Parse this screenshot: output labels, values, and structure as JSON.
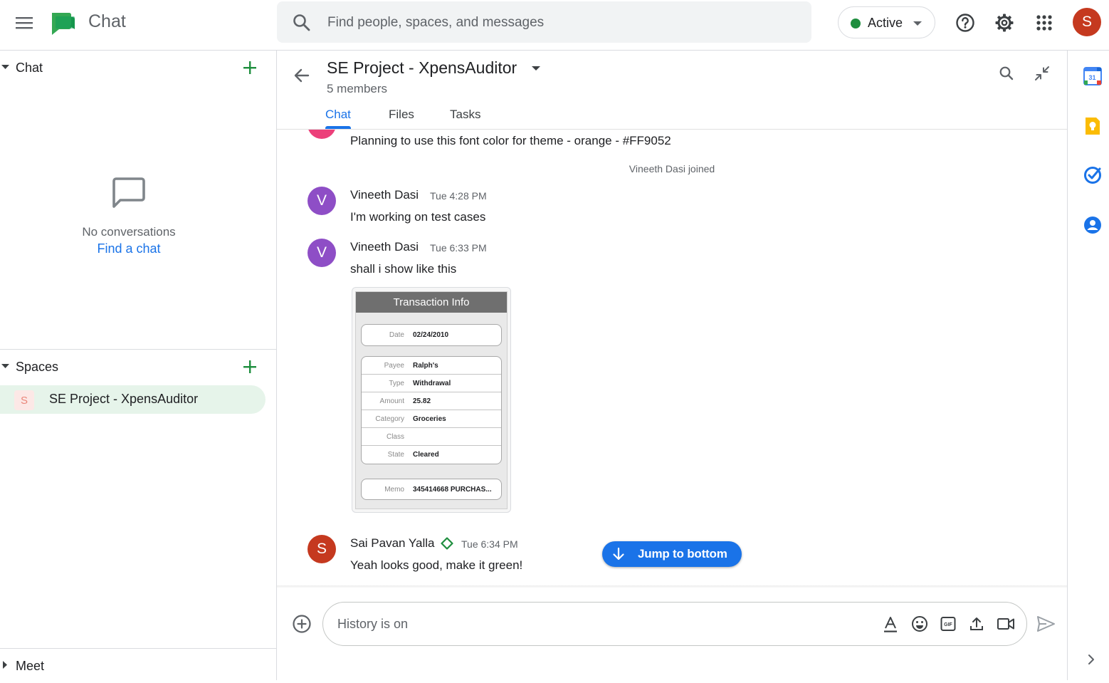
{
  "app": {
    "title": "Chat",
    "search_placeholder": "Find people, spaces, and messages",
    "status": "Active",
    "user_initial": "S"
  },
  "sidebar": {
    "chat_section": {
      "title": "Chat",
      "empty_text": "No conversations",
      "find_link": "Find a chat"
    },
    "spaces_section": {
      "title": "Spaces",
      "items": [
        {
          "initial": "S",
          "name": "SE Project - XpensAuditor"
        }
      ]
    },
    "meet_section": {
      "title": "Meet"
    }
  },
  "conversation": {
    "title": "SE Project - XpensAuditor",
    "members": "5 members",
    "tabs": [
      {
        "label": "Chat",
        "active": true
      },
      {
        "label": "Files",
        "active": false
      },
      {
        "label": "Tasks",
        "active": false
      }
    ]
  },
  "messages": {
    "prev_text": "Planning to use this font color for theme - orange - #FF9052",
    "system": "Vineeth Dasi joined",
    "items": [
      {
        "initial": "V",
        "author": "Vineeth Dasi",
        "time": "Tue 4:28 PM",
        "text": "I'm working on test cases",
        "avatar_color": "#8e4ec6"
      },
      {
        "initial": "V",
        "author": "Vineeth Dasi",
        "time": "Tue 6:33 PM",
        "text": "shall i show like this",
        "avatar_color": "#8e4ec6"
      },
      {
        "initial": "S",
        "author": "Sai Pavan Yalla",
        "time": "Tue 6:34 PM",
        "text": "Yeah looks good, make it green!",
        "avatar_color": "#c5391f"
      }
    ],
    "attachment": {
      "header": "Transaction Info",
      "date_label": "Date",
      "date_value": "02/24/2010",
      "rows": [
        {
          "label": "Payee",
          "value": "Ralph's"
        },
        {
          "label": "Type",
          "value": "Withdrawal"
        },
        {
          "label": "Amount",
          "value": "25.82"
        },
        {
          "label": "Category",
          "value": "Groceries"
        },
        {
          "label": "Class",
          "value": ""
        },
        {
          "label": "State",
          "value": "Cleared"
        }
      ],
      "memo_label": "Memo",
      "memo_value": "345414668 PURCHAS..."
    },
    "jump_label": "Jump to bottom"
  },
  "composer": {
    "placeholder": "History is on"
  },
  "colors": {
    "accent": "#1a73e8",
    "active_green": "#1e8e3e",
    "space_highlight": "#e6f4ea",
    "user_avatar": "#c5391f"
  },
  "icons": [
    "menu-icon",
    "chat-logo-icon",
    "search-icon",
    "caret-down-icon",
    "help-icon",
    "settings-icon",
    "apps-icon",
    "plus-icon",
    "chat-bubble-icon",
    "back-arrow-icon",
    "collapse-icon",
    "verified-diamond-icon",
    "arrow-down-icon",
    "add-circle-icon",
    "format-text-icon",
    "emoji-icon",
    "gif-icon",
    "upload-icon",
    "video-icon",
    "send-icon",
    "calendar-icon",
    "keep-icon",
    "tasks-icon",
    "contacts-icon",
    "chevron-right-icon"
  ]
}
